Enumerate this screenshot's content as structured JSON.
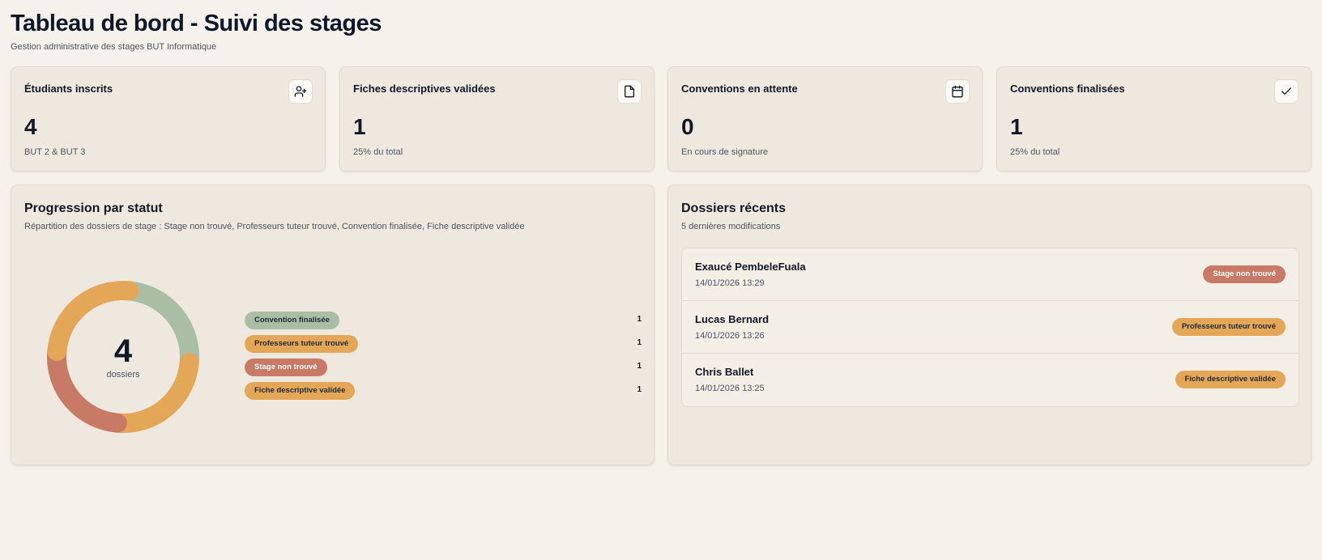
{
  "header": {
    "title": "Tableau de bord - Suivi des stages",
    "subtitle": "Gestion administrative des stages BUT Informatique"
  },
  "stats": [
    {
      "title": "Étudiants inscrits",
      "value": "4",
      "sub": "BUT 2 & BUT 3",
      "icon": "user-plus-icon"
    },
    {
      "title": "Fiches descriptives validées",
      "value": "1",
      "sub": "25% du total",
      "icon": "file-icon"
    },
    {
      "title": "Conventions en attente",
      "value": "0",
      "sub": "En cours de signature",
      "icon": "calendar-icon"
    },
    {
      "title": "Conventions finalisées",
      "value": "1",
      "sub": "25% du total",
      "icon": "check-icon"
    }
  ],
  "progress": {
    "title": "Progression par statut",
    "description": "Répartition des dossiers de stage : Stage non trouvé, Professeurs tuteur trouvé, Convention finalisée, Fiche descriptive validée",
    "total": "4",
    "total_label": "dossiers",
    "legend": [
      {
        "label": "Convention finalisée",
        "count": "1",
        "color": "#a9bea4"
      },
      {
        "label": "Professeurs tuteur trouvé",
        "count": "1",
        "color": "#e4a758"
      },
      {
        "label": "Stage non trouvé",
        "count": "1",
        "color": "#c97a66"
      },
      {
        "label": "Fiche descriptive validée",
        "count": "1",
        "color": "#e4a758"
      }
    ]
  },
  "chart_data": {
    "type": "pie",
    "categories": [
      "Convention finalisée",
      "Professeurs tuteur trouvé",
      "Stage non trouvé",
      "Fiche descriptive validée"
    ],
    "values": [
      1,
      1,
      1,
      1
    ],
    "colors": [
      "#a9bea4",
      "#e4a758",
      "#c97a66",
      "#e4a758"
    ],
    "style": "donut",
    "title": "Progression par statut"
  },
  "recent": {
    "title": "Dossiers récents",
    "subtitle": "5 dernières modifications",
    "items": [
      {
        "name": "Exaucé PembeleFuala",
        "date": "14/01/2026 13:29",
        "status": "Stage non trouvé",
        "color": "#c97a66"
      },
      {
        "name": "Lucas Bernard",
        "date": "14/01/2026 13:26",
        "status": "Professeurs tuteur trouvé",
        "color": "#e4a758"
      },
      {
        "name": "Chris Ballet",
        "date": "14/01/2026 13:25",
        "status": "Fiche descriptive validée",
        "color": "#e4a758"
      }
    ]
  },
  "colors": {
    "background": "#f5f2eb",
    "card": "#efe8de",
    "green": "#a9bea4",
    "orange": "#e4a758",
    "red": "#c97a66",
    "stage_non_trouve_badge_text": "#ffffff"
  }
}
